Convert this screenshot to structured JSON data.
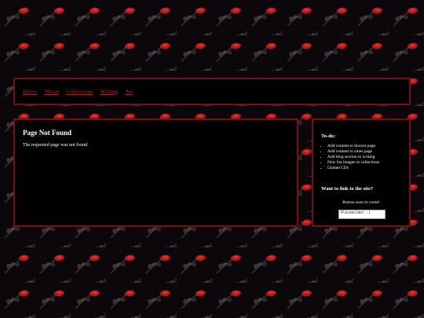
{
  "nav": {
    "items": [
      {
        "label": "Home"
      },
      {
        "label": "About"
      },
      {
        "label": "Collections"
      },
      {
        "label": "Writing"
      },
      {
        "label": "Art"
      }
    ]
  },
  "main": {
    "title": "Page Not Found",
    "message": "The requested page was not found."
  },
  "sidebar": {
    "todo_heading": "To-do:",
    "todo_items": [
      "Add content to linocut page",
      "Add content to zines page",
      "Add blog section to writing",
      "New list images to collections",
      "Update CDs"
    ],
    "link_heading": "Want to link to the site?",
    "button_note": "Button soon to come!",
    "link_code": "Placeholder :)"
  },
  "colors": {
    "page_background": "#0b070b",
    "panel_background": "#000000",
    "panel_border": "#7a0f0f",
    "nav_link": "#c4161c",
    "text": "#ffffff",
    "rose_petal": "#b11a1a"
  },
  "icons": {
    "background_motif": "rose-icon"
  }
}
